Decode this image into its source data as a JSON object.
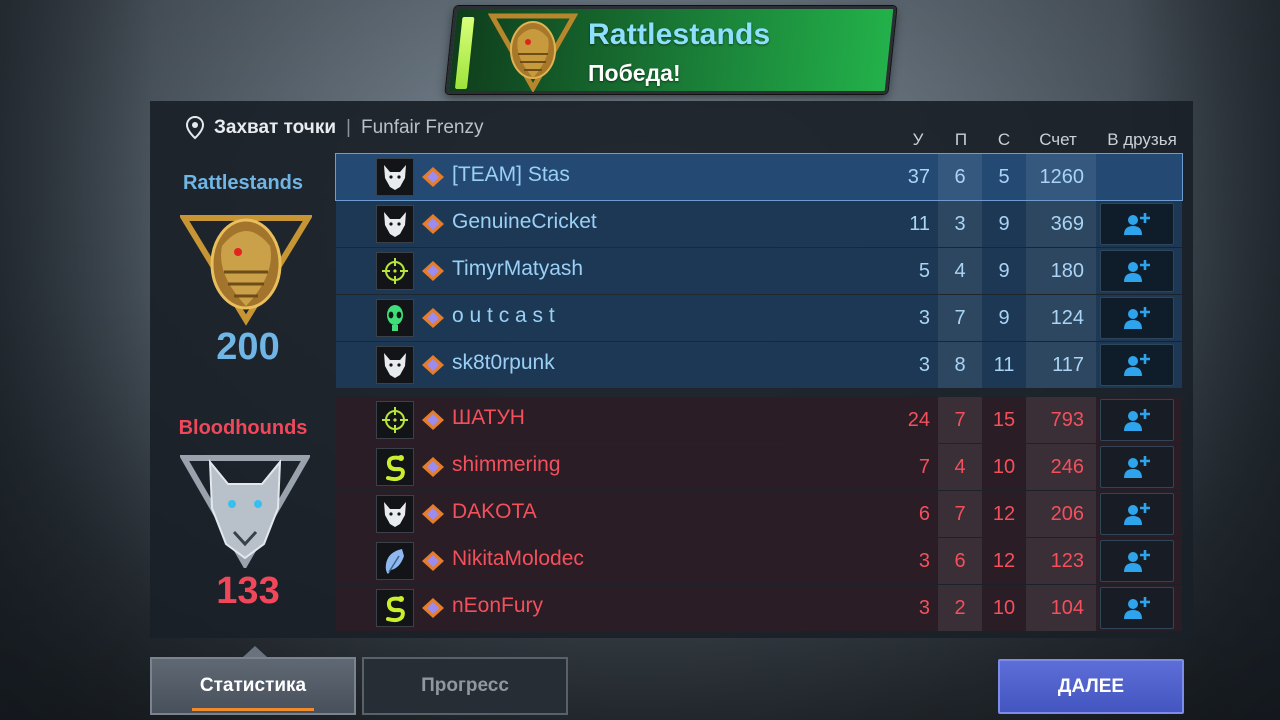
{
  "winner": {
    "team_name": "Rattlestands",
    "result": "Победа!"
  },
  "match": {
    "mode": "Захват точки",
    "separator": "|",
    "map": "Funfair Frenzy"
  },
  "columns": {
    "kills": "У",
    "deaths": "П",
    "assists": "С",
    "score": "Счет",
    "add_friend": "В друзья"
  },
  "teams": {
    "blue": {
      "name": "Rattlestands",
      "score": "200",
      "color": "#6fb6e6",
      "players": [
        {
          "name": "[TEAM] Stas",
          "avatar": "wolf-icon",
          "kills": "37",
          "deaths": "6",
          "assists": "5",
          "score": "1260",
          "can_add": false
        },
        {
          "name": "GenuineCricket",
          "avatar": "wolf-icon",
          "kills": "11",
          "deaths": "3",
          "assists": "9",
          "score": "369",
          "can_add": true
        },
        {
          "name": "TimyrMatyash",
          "avatar": "crosshair-icon",
          "kills": "5",
          "deaths": "4",
          "assists": "9",
          "score": "180",
          "can_add": true
        },
        {
          "name": "o u t c a s t",
          "avatar": "alien-icon",
          "kills": "3",
          "deaths": "7",
          "assists": "9",
          "score": "124",
          "can_add": true
        },
        {
          "name": "sk8t0rpunk",
          "avatar": "wolf-icon",
          "kills": "3",
          "deaths": "8",
          "assists": "11",
          "score": "117",
          "can_add": true
        }
      ]
    },
    "red": {
      "name": "Bloodhounds",
      "score": "133",
      "color": "#f0485a",
      "players": [
        {
          "name": "ШАТУН",
          "avatar": "crosshair-icon",
          "kills": "24",
          "deaths": "7",
          "assists": "15",
          "score": "793",
          "can_add": true
        },
        {
          "name": "shimmering",
          "avatar": "snake-icon",
          "kills": "7",
          "deaths": "4",
          "assists": "10",
          "score": "246",
          "can_add": true
        },
        {
          "name": "DAKOTA",
          "avatar": "wolf-icon",
          "kills": "6",
          "deaths": "7",
          "assists": "12",
          "score": "206",
          "can_add": true
        },
        {
          "name": "NikitaMolodec",
          "avatar": "feather-icon",
          "kills": "3",
          "deaths": "6",
          "assists": "12",
          "score": "123",
          "can_add": true
        },
        {
          "name": "nEonFury",
          "avatar": "snake-icon",
          "kills": "3",
          "deaths": "2",
          "assists": "10",
          "score": "104",
          "can_add": true
        }
      ]
    }
  },
  "buttons": {
    "stats_tab": "Статистика",
    "progress_tab": "Прогресс",
    "next": "ДАЛЕЕ"
  },
  "icons": {
    "location": "location-pin-icon",
    "rank": "rank-badge-icon",
    "add_friend": "add-friend-icon"
  }
}
